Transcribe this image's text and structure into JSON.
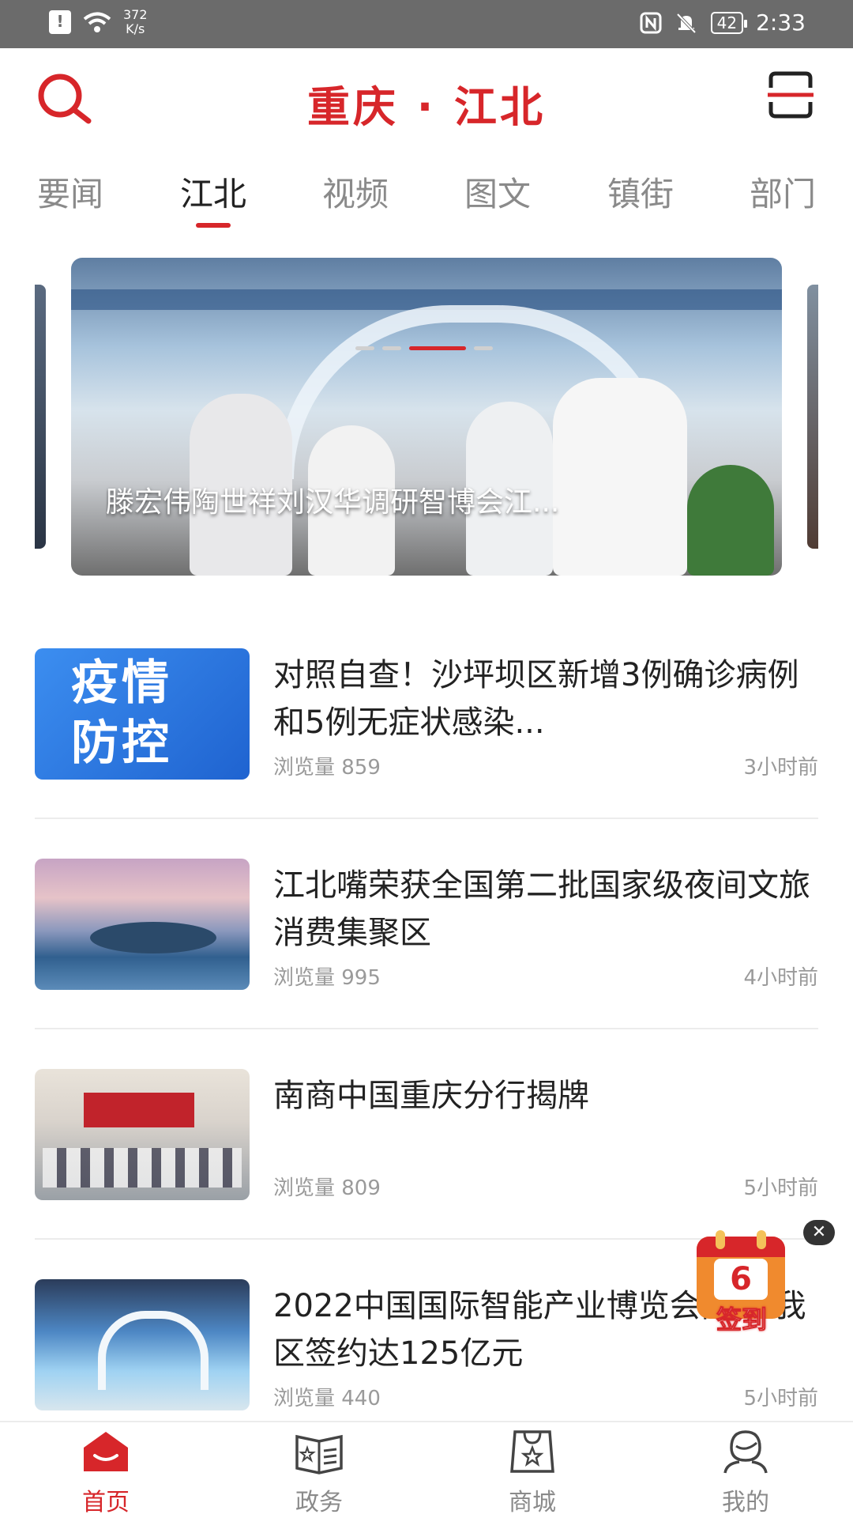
{
  "status_bar": {
    "net_speed_value": "372",
    "net_speed_unit": "K/s",
    "battery": "42",
    "time": "2:33"
  },
  "header": {
    "title": "重庆 · 江北"
  },
  "tabs": [
    {
      "label": "要闻",
      "active": false
    },
    {
      "label": "江北",
      "active": true
    },
    {
      "label": "视频",
      "active": false
    },
    {
      "label": "图文",
      "active": false
    },
    {
      "label": "镇街",
      "active": false
    },
    {
      "label": "部门",
      "active": false
    }
  ],
  "carousel": {
    "caption": "滕宏伟陶世祥刘汉华调研智博会江...",
    "slide_count": 4,
    "active_index": 2
  },
  "news": [
    {
      "thumb_text_line1": "疫情",
      "thumb_text_line2": "防控",
      "title": "对照自查！沙坪坝区新增3例确诊病例和5例无症状感染...",
      "views": "浏览量 859",
      "time": "3小时前"
    },
    {
      "title": "江北嘴荣获全国第二批国家级夜间文旅消费集聚区",
      "views": "浏览量 995",
      "time": "4小时前"
    },
    {
      "title": "南商中国重庆分行揭牌",
      "views": "浏览量 809",
      "time": "5小时前"
    },
    {
      "title": "2022中国国际智能产业博览会闭幕 我区签约达125亿元",
      "views": "浏览量 440",
      "time": "5小时前"
    }
  ],
  "checkin": {
    "day": "6",
    "label": "签到"
  },
  "bottom_nav": [
    {
      "label": "首页",
      "icon": "home-icon",
      "active": true
    },
    {
      "label": "政务",
      "icon": "gov-book-icon",
      "active": false
    },
    {
      "label": "商城",
      "icon": "shop-bag-icon",
      "active": false
    },
    {
      "label": "我的",
      "icon": "profile-icon",
      "active": false
    }
  ],
  "colors": {
    "accent": "#d7262a",
    "inactive": "#8a8a8a",
    "meta": "#9a9a9a"
  }
}
